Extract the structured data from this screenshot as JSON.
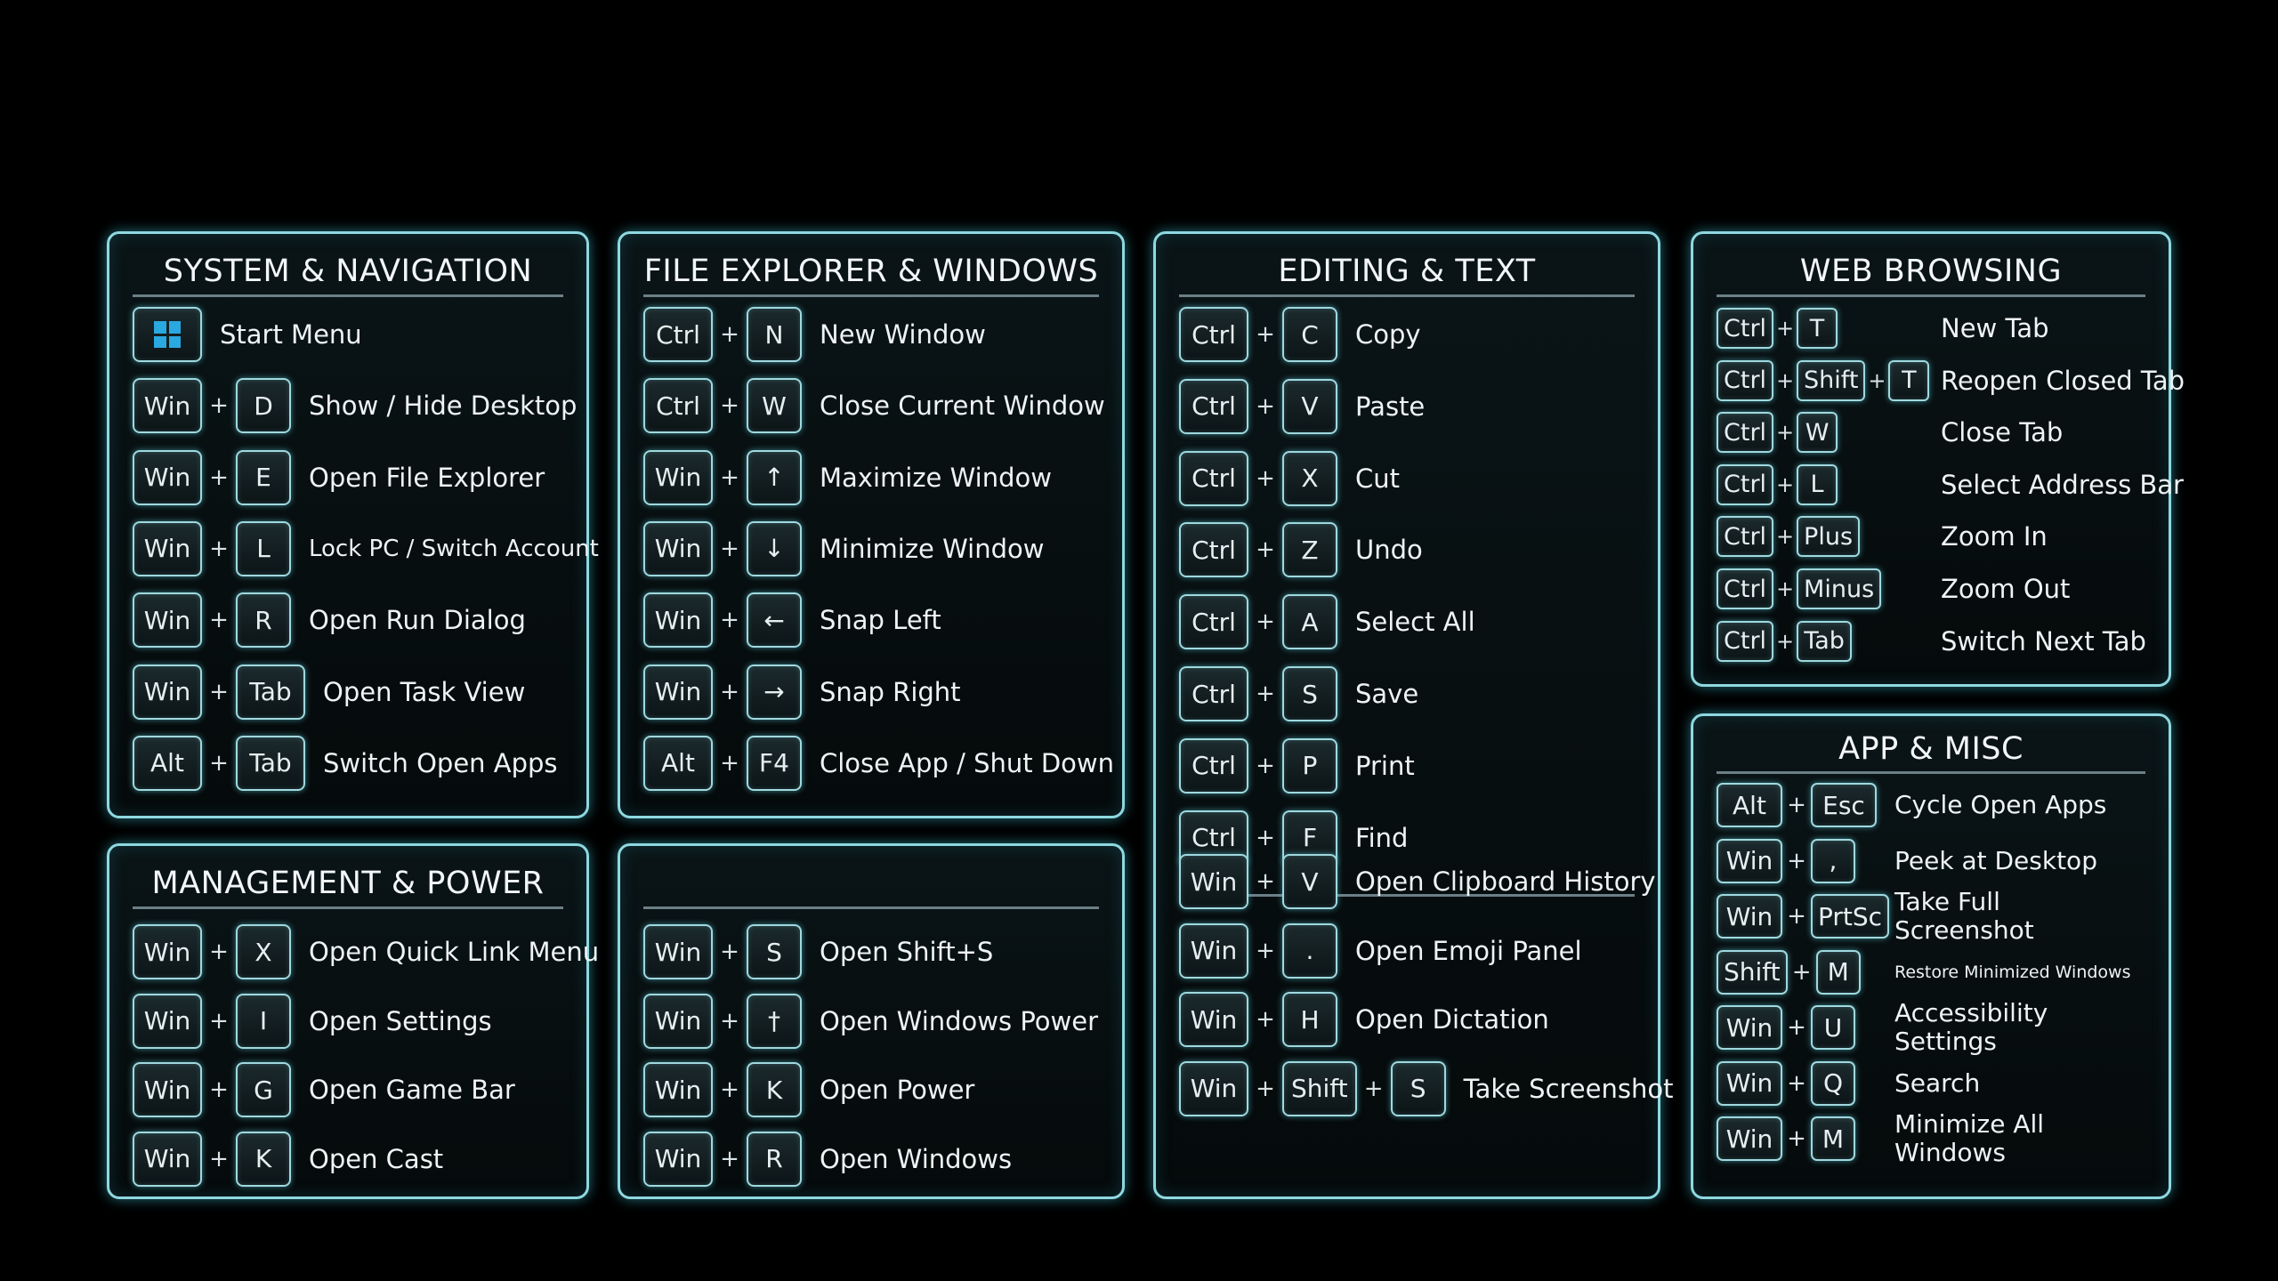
{
  "panels": {
    "system": {
      "title": "SYSTEM & NAVIGATION",
      "rows": [
        {
          "keys": [
            "windows-logo"
          ],
          "label": "Start Menu"
        },
        {
          "keys": [
            "Win",
            "D"
          ],
          "label": "Show / Hide Desktop"
        },
        {
          "keys": [
            "Win",
            "E"
          ],
          "label": "Open File Explorer"
        },
        {
          "keys": [
            "Win",
            "L"
          ],
          "label": "Lock PC / Switch Account"
        },
        {
          "keys": [
            "Win",
            "R"
          ],
          "label": "Open Run Dialog"
        },
        {
          "keys": [
            "Win",
            "Tab"
          ],
          "label": "Open Task View"
        },
        {
          "keys": [
            "Alt",
            "Tab"
          ],
          "label": "Switch Open Apps"
        }
      ]
    },
    "management": {
      "title": "MANAGEMENT & POWER",
      "rows": [
        {
          "keys": [
            "Win",
            "X"
          ],
          "label": "Open Quick Link Menu"
        },
        {
          "keys": [
            "Win",
            "I"
          ],
          "label": "Open Settings"
        },
        {
          "keys": [
            "Win",
            "G"
          ],
          "label": "Open Game Bar"
        },
        {
          "keys": [
            "Win",
            "K"
          ],
          "label": "Open Cast"
        }
      ]
    },
    "file_explorer": {
      "title": "FILE EXPLORER & WINDOWS",
      "rows": [
        {
          "keys": [
            "Ctrl",
            "N"
          ],
          "label": "New Window"
        },
        {
          "keys": [
            "Ctrl",
            "W"
          ],
          "label": "Close Current Window"
        },
        {
          "keys": [
            "Win",
            "↑"
          ],
          "label": "Maximize Window"
        },
        {
          "keys": [
            "Win",
            "↓"
          ],
          "label": "Minimize Window"
        },
        {
          "keys": [
            "Win",
            "←"
          ],
          "label": "Snap Left"
        },
        {
          "keys": [
            "Win",
            "→"
          ],
          "label": "Snap Right"
        },
        {
          "keys": [
            "Alt",
            "F4"
          ],
          "label": "Close App / Shut Down"
        }
      ]
    },
    "untitled": {
      "title": "",
      "rows": [
        {
          "keys": [
            "Win",
            "S"
          ],
          "label": "Open Shift+S"
        },
        {
          "keys": [
            "Win",
            "†"
          ],
          "label": "Open Windows Power"
        },
        {
          "keys": [
            "Win",
            "K"
          ],
          "label": "Open Power"
        },
        {
          "keys": [
            "Win",
            "R"
          ],
          "label": "Open Windows"
        }
      ]
    },
    "editing": {
      "title": "EDITING & TEXT",
      "rows": [
        {
          "keys": [
            "Ctrl",
            "C"
          ],
          "label": "Copy"
        },
        {
          "keys": [
            "Ctrl",
            "V"
          ],
          "label": "Paste"
        },
        {
          "keys": [
            "Ctrl",
            "X"
          ],
          "label": "Cut"
        },
        {
          "keys": [
            "Ctrl",
            "Z"
          ],
          "label": "Undo"
        },
        {
          "keys": [
            "Ctrl",
            "A"
          ],
          "label": "Select All"
        },
        {
          "keys": [
            "Ctrl",
            "S"
          ],
          "label": "Save"
        },
        {
          "keys": [
            "Ctrl",
            "P"
          ],
          "label": "Print"
        },
        {
          "keys": [
            "Ctrl",
            "F"
          ],
          "label": "Find"
        }
      ],
      "rows2": [
        {
          "keys": [
            "Win",
            "V"
          ],
          "label": "Open Clipboard History"
        },
        {
          "keys": [
            "Win",
            "."
          ],
          "label": "Open Emoji Panel"
        },
        {
          "keys": [
            "Win",
            "H"
          ],
          "label": "Open Dictation"
        },
        {
          "keys": [
            "Win",
            "Shift",
            "S"
          ],
          "label": "Take Screenshot"
        }
      ]
    },
    "web": {
      "title": "WEB BROWSING",
      "rows": [
        {
          "keys": [
            "Ctrl",
            "T"
          ],
          "label": "New Tab"
        },
        {
          "keys": [
            "Ctrl",
            "Shift",
            "T"
          ],
          "label": "Reopen Closed Tab"
        },
        {
          "keys": [
            "Ctrl",
            "W"
          ],
          "label": "Close Tab"
        },
        {
          "keys": [
            "Ctrl",
            "L"
          ],
          "label": "Select Address Bar"
        },
        {
          "keys": [
            "Ctrl",
            "Plus"
          ],
          "label": "Zoom In"
        },
        {
          "keys": [
            "Ctrl",
            "Minus"
          ],
          "label": "Zoom Out"
        },
        {
          "keys": [
            "Ctrl",
            "Tab"
          ],
          "label": "Switch Next Tab"
        }
      ]
    },
    "app": {
      "title": "APP & MISC",
      "rows": [
        {
          "keys": [
            "Alt",
            "Esc"
          ],
          "label": "Cycle Open Apps"
        },
        {
          "keys": [
            "Win",
            ","
          ],
          "label": "Peek at Desktop"
        },
        {
          "keys": [
            "Win",
            "PrtSc"
          ],
          "label": "Take Full Screenshot"
        },
        {
          "keys": [
            "Shift",
            "M"
          ],
          "label": "Restore Minimized Windows"
        },
        {
          "keys": [
            "Win",
            "U"
          ],
          "label": "Accessibility Settings"
        },
        {
          "keys": [
            "Win",
            "Q"
          ],
          "label": "Search"
        },
        {
          "keys": [
            "Win",
            "M"
          ],
          "label": "Minimize All Windows"
        }
      ]
    }
  },
  "plus_sign": "+",
  "colors": {
    "accent_glow": "#40c8dc",
    "border": "#8fd8e0",
    "windows_logo": "#2aa8e0"
  }
}
